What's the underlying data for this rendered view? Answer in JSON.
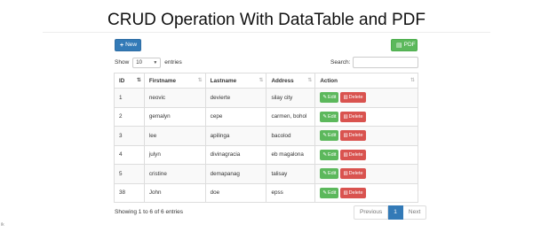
{
  "page": {
    "title": "CRUD Operation With DataTable and PDF"
  },
  "toolbar": {
    "new_label": "New",
    "pdf_label": "PDF"
  },
  "length": {
    "show_label": "Show",
    "value": "10",
    "entries_label": "entries"
  },
  "search": {
    "label": "Search:",
    "value": ""
  },
  "table": {
    "columns": [
      "ID",
      "Firstname",
      "Lastname",
      "Address",
      "Action"
    ],
    "rows": [
      [
        "1",
        "neovic",
        "devierte",
        "silay city"
      ],
      [
        "2",
        "gemalyn",
        "cepe",
        "carmen, bohol"
      ],
      [
        "3",
        "lee",
        "apilinga",
        "bacolod"
      ],
      [
        "4",
        "julyn",
        "divinagracia",
        "eb magalona"
      ],
      [
        "5",
        "cristine",
        "demapanag",
        "talisay"
      ],
      [
        "38",
        "John",
        "doe",
        "epss"
      ]
    ],
    "edit_label": "Edit",
    "delete_label": "Delete"
  },
  "footer": {
    "info": "Showing 1 to 6 of 6 entries"
  },
  "pagination": {
    "previous": "Previous",
    "current": "1",
    "next": "Next"
  },
  "corner": "ik"
}
